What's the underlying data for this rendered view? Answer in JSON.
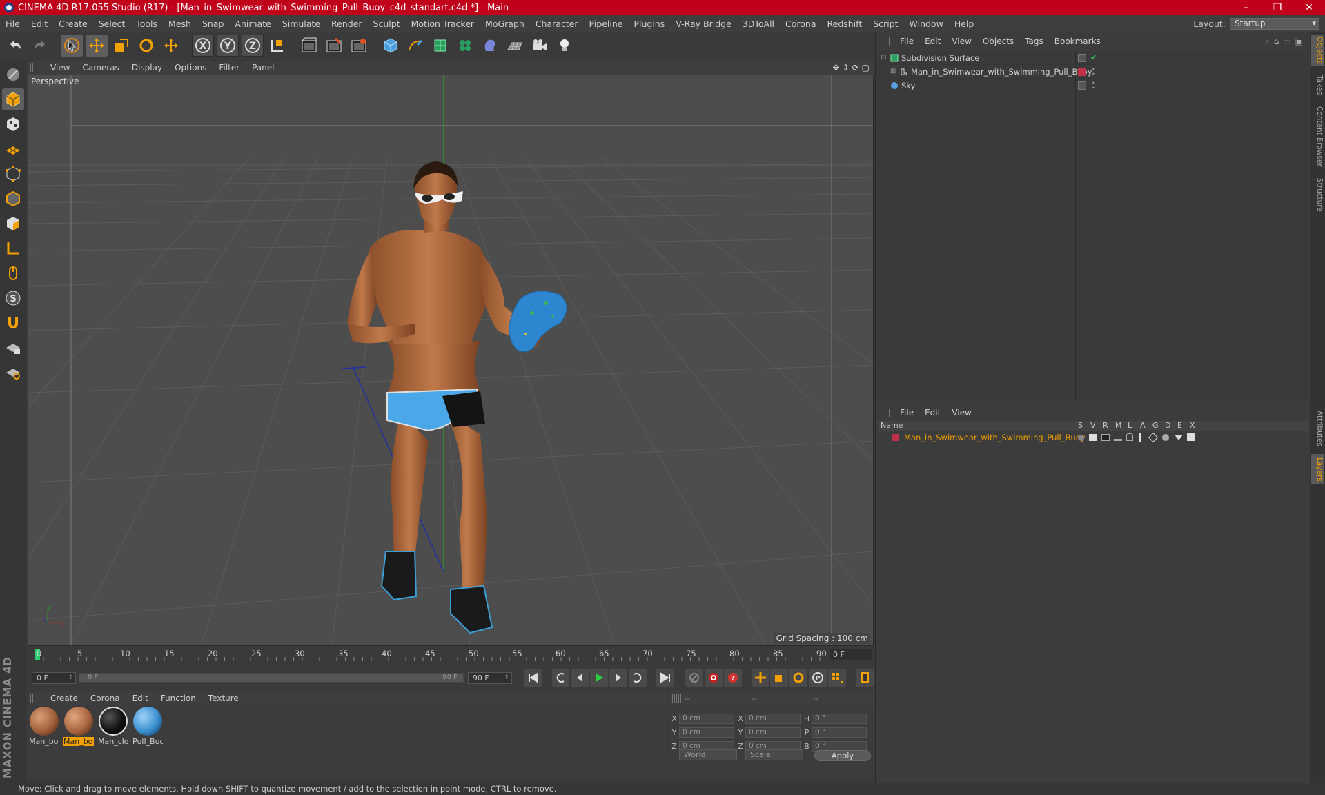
{
  "window": {
    "title": "CINEMA 4D R17.055 Studio (R17) - [Man_in_Swimwear_with_Swimming_Pull_Buoy_c4d_standart.c4d *] - Main",
    "controls": [
      "–",
      "❐",
      "✕"
    ]
  },
  "menu": [
    "File",
    "Edit",
    "Create",
    "Select",
    "Tools",
    "Mesh",
    "Snap",
    "Animate",
    "Simulate",
    "Render",
    "Sculpt",
    "Motion Tracker",
    "MoGraph",
    "Character",
    "Pipeline",
    "Plugins",
    "V-Ray Bridge",
    "3DToAll",
    "Corona",
    "Redshift",
    "Script",
    "Window",
    "Help"
  ],
  "layout": {
    "label": "Layout:",
    "value": "Startup"
  },
  "viewport": {
    "menu": [
      "View",
      "Cameras",
      "Display",
      "Options",
      "Filter",
      "Panel"
    ],
    "camera_label": "Perspective",
    "grid_spacing": "Grid Spacing : 100 cm",
    "nav_icons": [
      "✥",
      "⇕",
      "⟳",
      "▢"
    ]
  },
  "timeline": {
    "ticks": [
      "0",
      "5",
      "10",
      "15",
      "20",
      "25",
      "30",
      "35",
      "40",
      "45",
      "50",
      "55",
      "60",
      "65",
      "70",
      "75",
      "80",
      "85",
      "90"
    ],
    "current_frame": "0 F",
    "start_field": "0 F",
    "range_start": "0 F",
    "range_end": "90 F",
    "end_field": "90 F"
  },
  "materials": {
    "menu": [
      "Create",
      "Corona",
      "Edit",
      "Function",
      "Texture"
    ],
    "items": [
      {
        "name": "Man_bo",
        "color": "#a0603a",
        "selected": false
      },
      {
        "name": "Man_bo",
        "color": "#a86440",
        "selected": true
      },
      {
        "name": "Man_clo",
        "color": "#111111",
        "selected": false
      },
      {
        "name": "Pull_Buo",
        "color": "#3a8fd0",
        "selected": false
      }
    ]
  },
  "coordinates": {
    "header": [
      "--",
      "--",
      "--"
    ],
    "rows": [
      {
        "a1": "X",
        "v1": "0 cm",
        "a2": "X",
        "v2": "0 cm",
        "a3": "H",
        "v3": "0 °"
      },
      {
        "a1": "Y",
        "v1": "0 cm",
        "a2": "Y",
        "v2": "0 cm",
        "a3": "P",
        "v3": "0 °"
      },
      {
        "a1": "Z",
        "v1": "0 cm",
        "a2": "Z",
        "v2": "0 cm",
        "a3": "B",
        "v3": "0 °"
      }
    ],
    "mode": "World",
    "transform": "Scale",
    "apply": "Apply"
  },
  "status": "Move: Click and drag to move elements. Hold down SHIFT to quantize movement / add to the selection in point mode, CTRL to remove.",
  "object_manager": {
    "menu": [
      "File",
      "Edit",
      "View",
      "Objects",
      "Tags",
      "Bookmarks"
    ],
    "objects": [
      {
        "name": "Subdivision Surface",
        "indent": 0,
        "color": "#39b54a"
      },
      {
        "name": "Man_in_Swimwear_with_Swimming_Pull_Buoy",
        "indent": 1,
        "color": "#c8c8c8"
      },
      {
        "name": "Sky",
        "indent": 0,
        "color": "#5aa0e0"
      }
    ]
  },
  "layer_manager": {
    "menu": [
      "File",
      "Edit",
      "View"
    ],
    "headers": [
      "Name",
      "S",
      "V",
      "R",
      "M",
      "L",
      "A",
      "G",
      "D",
      "E",
      "X"
    ],
    "layers": [
      {
        "name": "Man_in_Swimwear_with_Swimming_Pull_Buoy",
        "color": "#c0304a"
      }
    ]
  },
  "side_tabs": [
    "Objects",
    "Takes",
    "Content Browser",
    "Structure",
    "Attributes",
    "Layers"
  ]
}
